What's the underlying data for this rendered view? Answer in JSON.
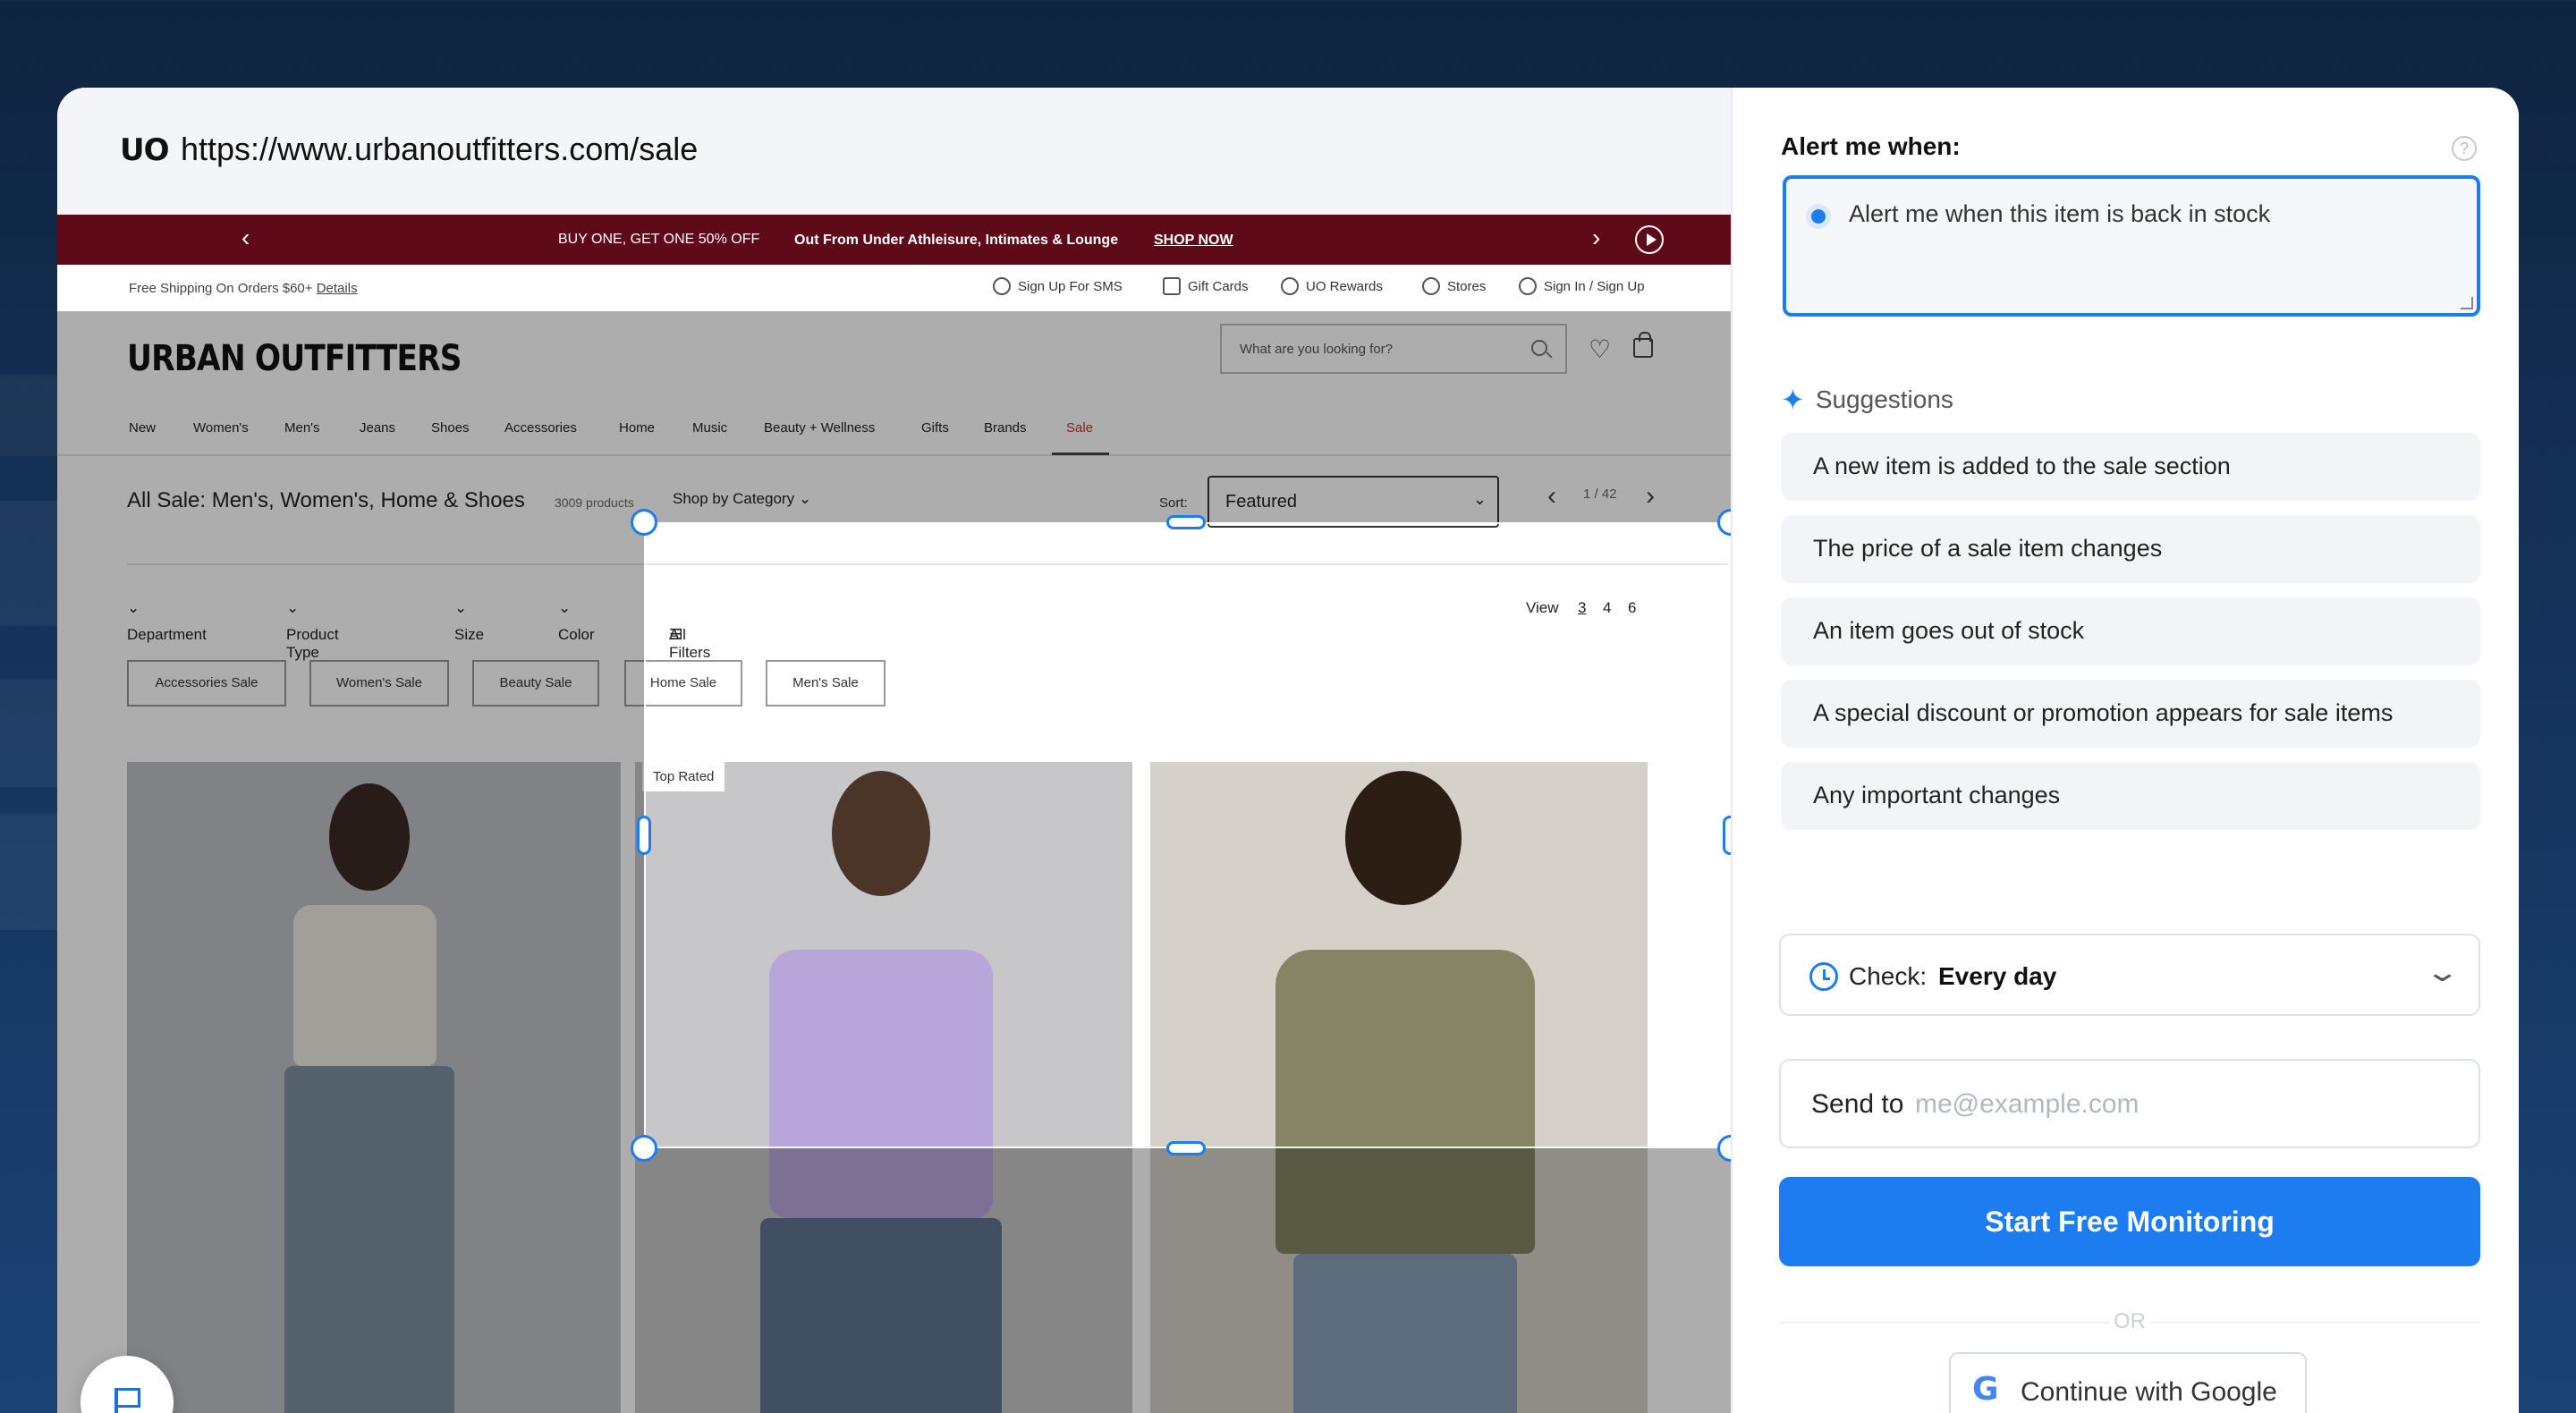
{
  "preview": {
    "logo": "UO",
    "url": "https://www.urbanoutfitters.com/sale"
  },
  "site": {
    "promo": {
      "text1": "BUY ONE, GET ONE 50% OFF",
      "text2": "Out From Under Athleisure, Intimates & Lounge",
      "link": "SHOP NOW"
    },
    "utility": {
      "shipping": "Free Shipping On Orders $60+",
      "details": "Details",
      "links": [
        "Sign Up For SMS",
        "Gift Cards",
        "UO Rewards",
        "Stores",
        "Sign In / Sign Up"
      ]
    },
    "brand": "URBAN OUTFITTERS",
    "search_placeholder": "What are you looking for?",
    "nav": [
      "New",
      "Women's",
      "Men's",
      "Jeans",
      "Shoes",
      "Accessories",
      "Home",
      "Music",
      "Beauty + Wellness",
      "Gifts",
      "Brands",
      "Sale"
    ],
    "page_title": "All Sale: Men's, Women's, Home & Shoes",
    "product_count": "3009 products",
    "shop_by_category": "Shop by Category",
    "sort_label": "Sort:",
    "sort_value": "Featured",
    "pager": "1 / 42",
    "filters": [
      "Department",
      "Product Type",
      "Size",
      "Color",
      "All Filters"
    ],
    "view_label": "View",
    "view_options": [
      "3",
      "4",
      "6"
    ],
    "chips": [
      "Accessories Sale",
      "Women's Sale",
      "Beauty Sale",
      "Home Sale",
      "Men's Sale"
    ],
    "badge": "Top Rated"
  },
  "panel": {
    "alert_label": "Alert me when:",
    "help": "?",
    "alert_text": "Alert me when this item is back in stock",
    "suggestions_label": "Suggestions",
    "suggestions": [
      "A new item is added to the sale section",
      "The price of a sale item changes",
      "An item goes out of stock",
      "A special discount or promotion appears for sale items",
      "Any important changes"
    ],
    "check_label": "Check:",
    "check_value": "Every day",
    "send_label": "Send to",
    "send_placeholder": "me@example.com",
    "start_button": "Start Free Monitoring",
    "or_text": "OR",
    "google_g": "G",
    "google_button": "Continue with Google"
  },
  "colors": {
    "accent": "#1d7df0",
    "promo_bg": "#5e0a18",
    "page_bg": "#0f2440"
  }
}
